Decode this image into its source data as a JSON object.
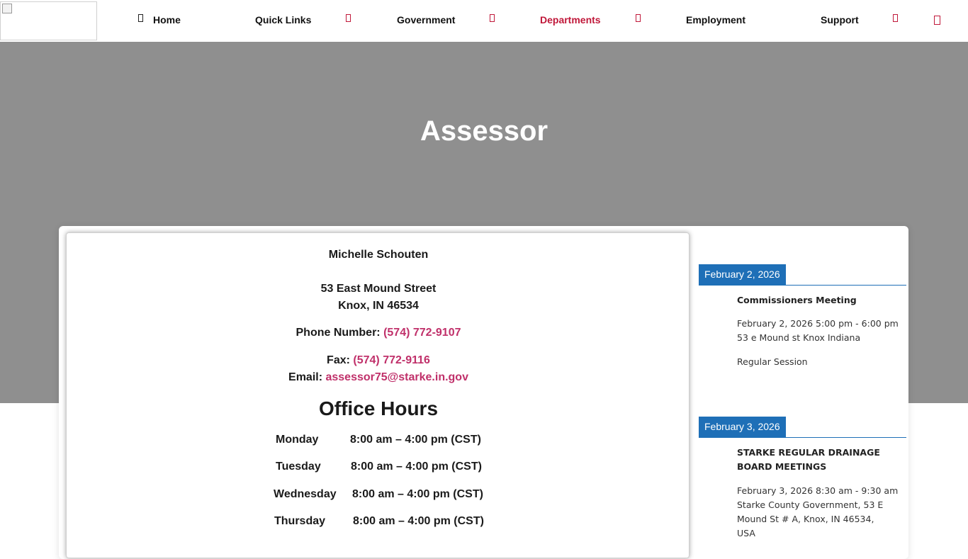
{
  "nav": {
    "items": [
      {
        "label": "Home"
      },
      {
        "label": "Quick Links"
      },
      {
        "label": "Government"
      },
      {
        "label": "Departments"
      },
      {
        "label": "Employment"
      },
      {
        "label": "Support"
      }
    ],
    "active_item": "Departments",
    "accent_color": "#c0183a"
  },
  "hero": {
    "title": "Assessor",
    "background_color": "#8f8f8f"
  },
  "contact": {
    "name": "Michelle Schouten",
    "address_line1": "53 East Mound Street",
    "address_line2": "Knox, IN 46534",
    "phone_label": "Phone Number:",
    "phone": "(574) 772-9107",
    "fax_label": "Fax:",
    "fax": "(574) 772-9116",
    "email_label": "Email:",
    "email": "assessor75@starke.in.gov",
    "link_color": "#c0306a"
  },
  "office_hours": {
    "title": "Office Hours",
    "rows": [
      {
        "day": "Monday",
        "time": "8:00 am – 4:00 pm (CST)"
      },
      {
        "day": "Tuesday",
        "time": "8:00 am – 4:00 pm (CST)"
      },
      {
        "day": "Wednesday",
        "time": "8:00 am – 4:00 pm (CST)"
      },
      {
        "day": "Thursday",
        "time": "8:00 am – 4:00 pm (CST)"
      }
    ]
  },
  "events": {
    "tab_color": "#1e6fb7",
    "items": [
      {
        "date": "February 2, 2026",
        "title": "Commissioners Meeting",
        "datetime": "February 2, 2026  5:00 pm - 6:00 pm",
        "location": "53 e Mound st Knox Indiana",
        "description": "Regular Session"
      },
      {
        "date": "February 3, 2026",
        "title": "STARKE REGULAR DRAINAGE BOARD MEETINGS",
        "datetime": "February 3, 2026  8:30 am - 9:30 am",
        "location": "Starke County Government, 53 E Mound St # A, Knox, IN 46534, USA"
      }
    ]
  }
}
